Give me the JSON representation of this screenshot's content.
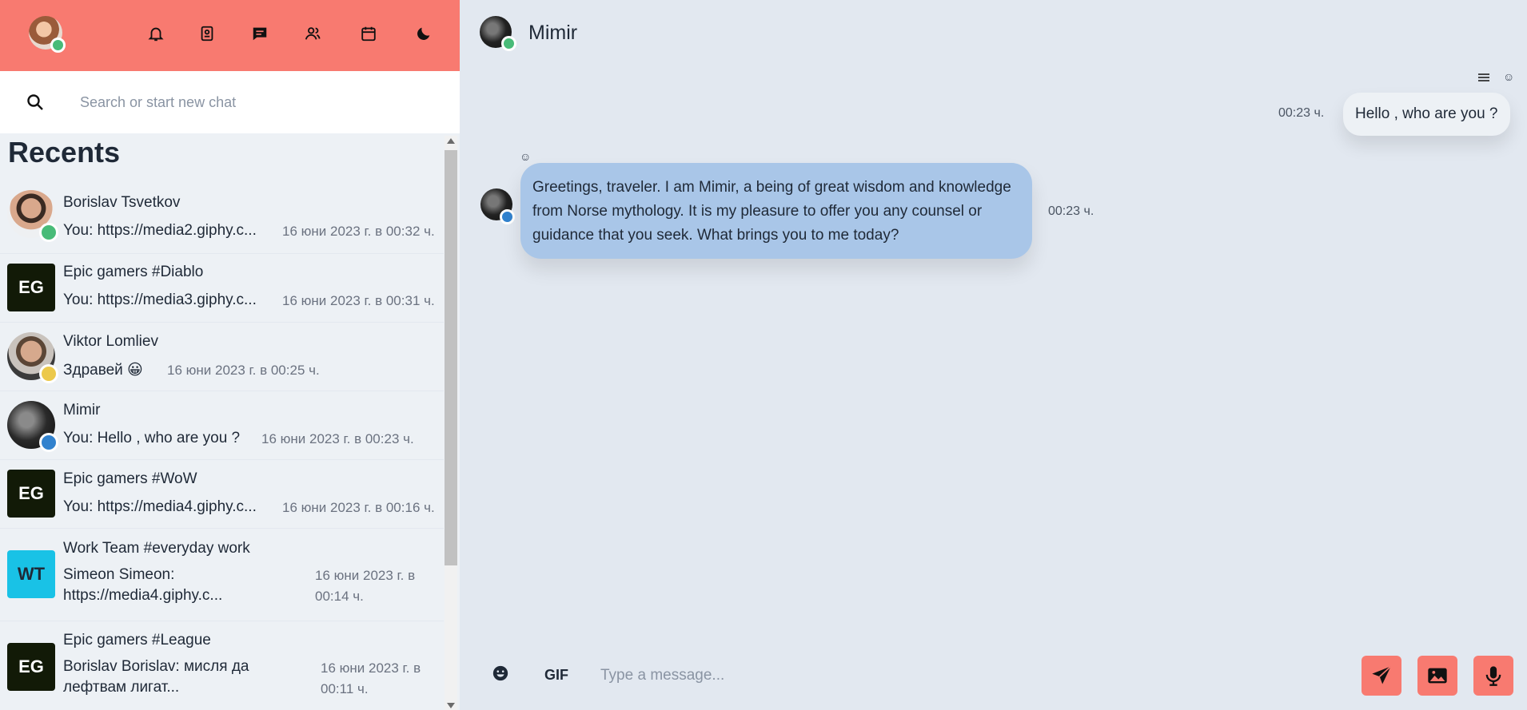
{
  "colors": {
    "topbar": "#f87a70",
    "online": "#48bb78",
    "away": "#ecc94b",
    "bot": "#3182ce",
    "incoming_bubble": "#a9c6e8",
    "accent_button": "#f87a70"
  },
  "topbar": {
    "icons": [
      "bell-icon",
      "contact-card-icon",
      "chat-bubble-icon",
      "people-icon",
      "calendar-icon",
      "moon-icon"
    ]
  },
  "search": {
    "placeholder": "Search or start new chat"
  },
  "recents": {
    "title": "Recents",
    "items": [
      {
        "name": "Borislav Tsvetkov",
        "preview": "You: https://media2.giphy.c...",
        "date": "16 юни 2023 г. в 00:32 ч.",
        "avatar": "photo",
        "status": "online"
      },
      {
        "name": "Epic gamers #Diablo",
        "preview": "You: https://media3.giphy.c...",
        "date": "16 юни 2023 г. в 00:31 ч.",
        "initials": "EG"
      },
      {
        "name": "Viktor Lomliev",
        "preview": "Здравей 😀",
        "date": "16 юни 2023 г. в 00:25 ч.",
        "avatar": "photo",
        "status": "away"
      },
      {
        "name": "Mimir",
        "preview": "You: Hello , who are you ?",
        "date": "16 юни 2023 г. в 00:23 ч.",
        "avatar": "photo",
        "status": "bot"
      },
      {
        "name": "Epic gamers #WoW",
        "preview": "You: https://media4.giphy.c...",
        "date": "16 юни 2023 г. в 00:16 ч.",
        "initials": "EG"
      },
      {
        "name": "Work Team #everyday work",
        "preview": "Simeon Simeon: https://media4.giphy.c...",
        "date": "16 юни 2023 г. в 00:14 ч.",
        "initials": "WT"
      },
      {
        "name": "Epic gamers #League",
        "preview": "Borislav Borislav: мисля да лефтвам лигат...",
        "date": "16 юни 2023 г. в 00:11 ч.",
        "initials": "EG"
      }
    ]
  },
  "chat": {
    "name": "Mimir",
    "messages": [
      {
        "direction": "out",
        "text": "Hello , who are you ?",
        "time": "00:23 ч."
      },
      {
        "direction": "in",
        "text": "Greetings, traveler. I am Mimir, a being of great wisdom and knowledge from Norse mythology. It is my pleasure to offer you any counsel or guidance that you seek. What brings you to me today?",
        "time": "00:23 ч."
      }
    ]
  },
  "composer": {
    "gif_label": "GIF",
    "placeholder": "Type a message...",
    "buttons": [
      "send-icon",
      "image-icon",
      "microphone-icon"
    ]
  }
}
